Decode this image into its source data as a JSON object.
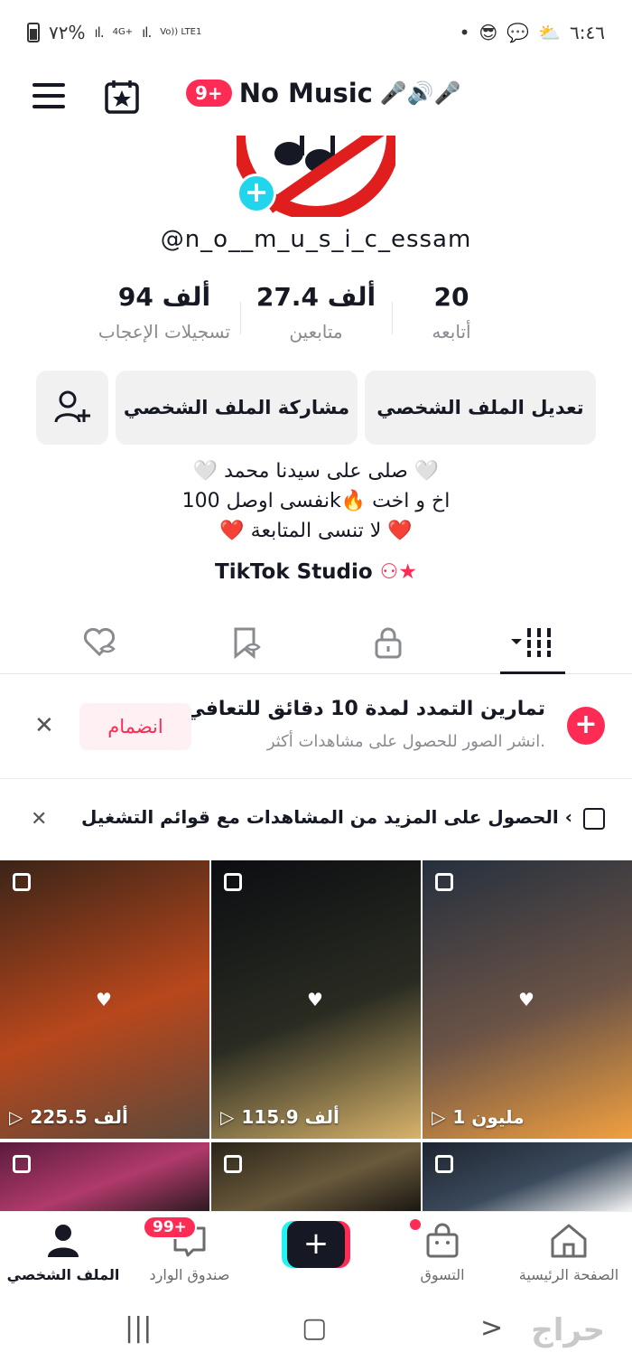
{
  "status_bar": {
    "time": "٦:٤٦",
    "battery_percent": "٧٢%",
    "network": "4G+",
    "carrier": "Vo)) LTE1"
  },
  "header": {
    "notification_badge": "9+",
    "account_title": "No Music",
    "title_emojis": "🎤🔊🎤"
  },
  "profile": {
    "username": "@n_o__m_u_s_i_c_essam",
    "stats": [
      {
        "value": "20",
        "label": "أتابعه"
      },
      {
        "value": "27.4 ألف",
        "label": "متابعين"
      },
      {
        "value": "94 ألف",
        "label": "تسجيلات الإعجاب"
      }
    ],
    "edit_button": "تعديل الملف الشخصي",
    "share_button": "مشاركة الملف الشخصي",
    "bio_lines": [
      "🤍 صلى على سيدنا محمد 🤍",
      "نفسى اوصل 100k🔥 اخ و اخت",
      "❤️ لا تنسى المتابعة ❤️"
    ],
    "studio_link": "TikTok Studio"
  },
  "challenge": {
    "title": "تمارين التمدد لمدة 10 دقائق للتعافي",
    "subtitle": "انشر الصور للحصول على مشاهدات أكثر.",
    "join_label": "انضمام"
  },
  "playlist_prompt": {
    "text": "الحصول على المزيد من المشاهدات مع قوائم التشغيل ‹"
  },
  "videos": [
    {
      "views": "225.5 ألف",
      "colors": [
        "#3a2418",
        "#b8471c",
        "#5c4a3c"
      ]
    },
    {
      "views": "115.9 ألف",
      "colors": [
        "#0b0d12",
        "#2a2c22",
        "#d8b36a"
      ]
    },
    {
      "views": "1 مليون",
      "colors": [
        "#25303e",
        "#6b5346",
        "#f0a040"
      ]
    },
    {
      "views": "",
      "colors": [
        "#5a1b3c",
        "#b03a6b",
        "#2c1a20"
      ]
    },
    {
      "views": "",
      "colors": [
        "#2a2418",
        "#6a5a3c",
        "#1a1712"
      ]
    },
    {
      "views": "",
      "colors": [
        "#1e2430",
        "#3b4a5c",
        "#f5f5f5"
      ]
    }
  ],
  "bottom_nav": {
    "home": "الصفحة الرئيسية",
    "shop": "التسوق",
    "inbox": "صندوق الوارد",
    "inbox_badge": "99+",
    "profile": "الملف الشخصي"
  },
  "accent_colors": {
    "tiktok_red": "#fe2c55",
    "tiktok_cyan": "#25f4ee"
  },
  "watermark": "حراج"
}
